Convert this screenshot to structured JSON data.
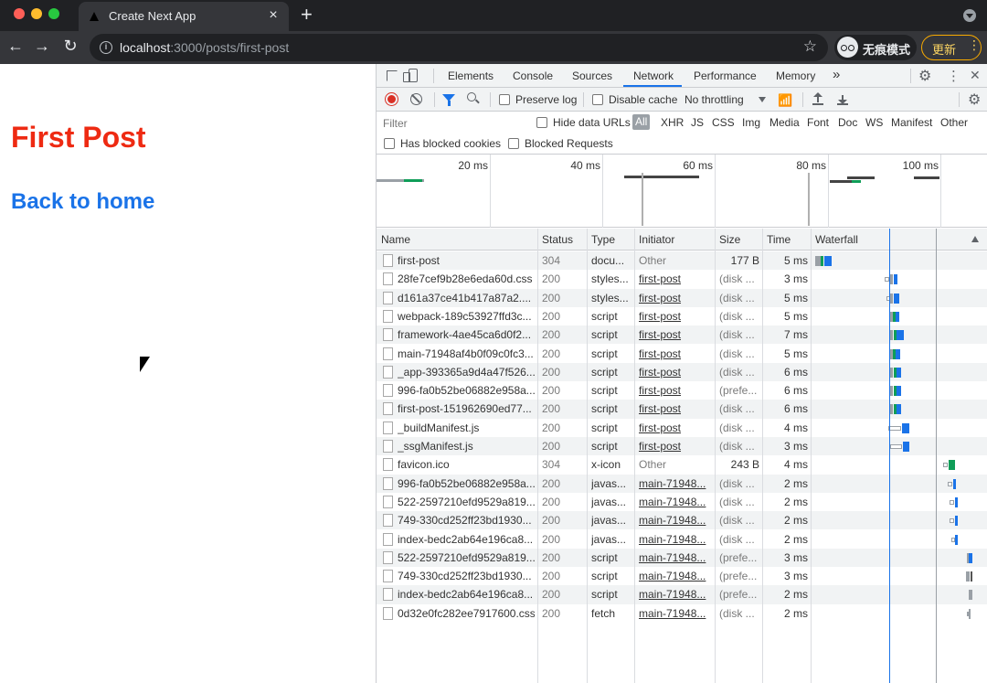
{
  "browser": {
    "tab_title": "Create Next App",
    "tab_close": "×",
    "new_tab": "+",
    "url_host": "localhost",
    "url_rest": ":3000/posts/first-post",
    "incognito_label": "无痕模式",
    "update_label": "更新",
    "update_dots": "⋮",
    "back": "←",
    "forward": "→",
    "reload": "↻",
    "star": "☆"
  },
  "page": {
    "title": "First Post",
    "back_link": "Back to home"
  },
  "devtools": {
    "tabs": [
      "Elements",
      "Console",
      "Sources",
      "Network",
      "Performance",
      "Memory"
    ],
    "more_tabs": "»",
    "kebab": "⋮",
    "close": "✕",
    "active_tab": "Network",
    "preserve_log": "Preserve log",
    "disable_cache": "Disable cache",
    "throttling": "No throttling",
    "filter_placeholder": "Filter",
    "hide_data_urls": "Hide data URLs",
    "type_filters": [
      "All",
      "XHR",
      "JS",
      "CSS",
      "Img",
      "Media",
      "Font",
      "Doc",
      "WS",
      "Manifest",
      "Other"
    ],
    "has_blocked_cookies": "Has blocked cookies",
    "blocked_requests": "Blocked Requests",
    "overview_ticks": [
      "20 ms",
      "40 ms",
      "60 ms",
      "80 ms",
      "100 ms"
    ],
    "columns": [
      "Name",
      "Status",
      "Type",
      "Initiator",
      "Size",
      "Time",
      "Waterfall"
    ],
    "rows": [
      {
        "name": "first-post",
        "status": "304",
        "type": "docu...",
        "initiator": "Other",
        "size": "177 B",
        "time": "5 ms"
      },
      {
        "name": "28fe7cef9b28e6eda60d.css",
        "status": "200",
        "type": "styles...",
        "initiator": "first-post",
        "size": "(disk ...",
        "time": "3 ms"
      },
      {
        "name": "d161a37ce41b417a87a2....",
        "status": "200",
        "type": "styles...",
        "initiator": "first-post",
        "size": "(disk ...",
        "time": "5 ms"
      },
      {
        "name": "webpack-189c53927ffd3c...",
        "status": "200",
        "type": "script",
        "initiator": "first-post",
        "size": "(disk ...",
        "time": "5 ms"
      },
      {
        "name": "framework-4ae45ca6d0f2...",
        "status": "200",
        "type": "script",
        "initiator": "first-post",
        "size": "(disk ...",
        "time": "7 ms"
      },
      {
        "name": "main-71948af4b0f09c0fc3...",
        "status": "200",
        "type": "script",
        "initiator": "first-post",
        "size": "(disk ...",
        "time": "5 ms"
      },
      {
        "name": "_app-393365a9d4a47f526...",
        "status": "200",
        "type": "script",
        "initiator": "first-post",
        "size": "(disk ...",
        "time": "6 ms"
      },
      {
        "name": "996-fa0b52be06882e958a...",
        "status": "200",
        "type": "script",
        "initiator": "first-post",
        "size": "(prefe...",
        "time": "6 ms"
      },
      {
        "name": "first-post-151962690ed77...",
        "status": "200",
        "type": "script",
        "initiator": "first-post",
        "size": "(disk ...",
        "time": "6 ms"
      },
      {
        "name": "_buildManifest.js",
        "status": "200",
        "type": "script",
        "initiator": "first-post",
        "size": "(disk ...",
        "time": "4 ms"
      },
      {
        "name": "_ssgManifest.js",
        "status": "200",
        "type": "script",
        "initiator": "first-post",
        "size": "(disk ...",
        "time": "3 ms"
      },
      {
        "name": "favicon.ico",
        "status": "304",
        "type": "x-icon",
        "initiator": "Other",
        "size": "243 B",
        "time": "4 ms"
      },
      {
        "name": "996-fa0b52be06882e958a...",
        "status": "200",
        "type": "javas...",
        "initiator": "main-71948...",
        "size": "(disk ...",
        "time": "2 ms"
      },
      {
        "name": "522-2597210efd9529a819...",
        "status": "200",
        "type": "javas...",
        "initiator": "main-71948...",
        "size": "(disk ...",
        "time": "2 ms"
      },
      {
        "name": "749-330cd252ff23bd1930...",
        "status": "200",
        "type": "javas...",
        "initiator": "main-71948...",
        "size": "(disk ...",
        "time": "2 ms"
      },
      {
        "name": "index-bedc2ab64e196ca8...",
        "status": "200",
        "type": "javas...",
        "initiator": "main-71948...",
        "size": "(disk ...",
        "time": "2 ms"
      },
      {
        "name": "522-2597210efd9529a819...",
        "status": "200",
        "type": "script",
        "initiator": "main-71948...",
        "size": "(prefe...",
        "time": "3 ms"
      },
      {
        "name": "749-330cd252ff23bd1930...",
        "status": "200",
        "type": "script",
        "initiator": "main-71948...",
        "size": "(prefe...",
        "time": "3 ms"
      },
      {
        "name": "index-bedc2ab64e196ca8...",
        "status": "200",
        "type": "script",
        "initiator": "main-71948...",
        "size": "(prefe...",
        "time": "2 ms"
      },
      {
        "name": "0d32e0fc282ee7917600.css",
        "status": "200",
        "type": "fetch",
        "initiator": "main-71948...",
        "size": "(disk ...",
        "time": "2 ms"
      }
    ]
  },
  "colors": {
    "post_title": "#ee2a12",
    "link": "#1a73e8",
    "record": "#d93025",
    "waterfall_blue": "#1a73e8",
    "waterfall_green": "#0f9d58"
  }
}
